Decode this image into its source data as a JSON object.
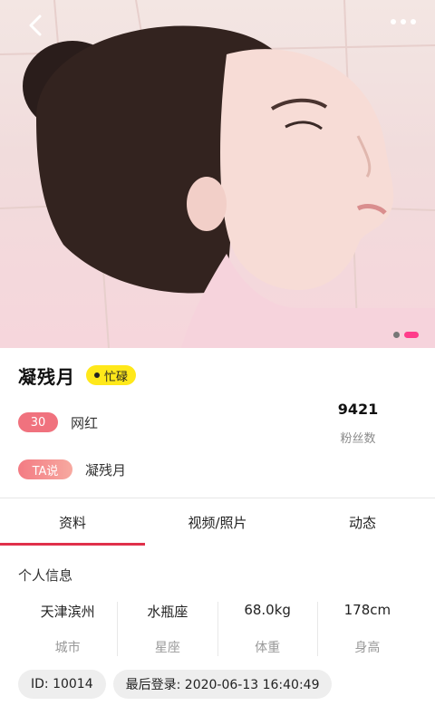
{
  "profile": {
    "name": "凝残月",
    "status": "忙碌",
    "age": "30",
    "tag": "网红",
    "ta_badge": "TA说",
    "ta_text": "凝残月",
    "fans_count": "9421",
    "fans_label": "粉丝数"
  },
  "carousel": {
    "current_index": 2,
    "total": 2
  },
  "tabs": [
    {
      "label": "资料",
      "active": true
    },
    {
      "label": "视频/照片",
      "active": false
    },
    {
      "label": "动态",
      "active": false
    }
  ],
  "section_title": "个人信息",
  "info": [
    {
      "value": "天津滨州",
      "label": "城市"
    },
    {
      "value": "水瓶座",
      "label": "星座"
    },
    {
      "value": "68.0kg",
      "label": "体重"
    },
    {
      "value": "178cm",
      "label": "身高"
    }
  ],
  "chips": {
    "id": "ID: 10014",
    "last_login": "最后登录: 2020-06-13 16:40:49"
  },
  "icons": {
    "back": "back-arrow-icon",
    "more": "more-dots-icon"
  },
  "colors": {
    "accent": "#e0304a",
    "status_bg": "#ffe81a",
    "age_badge": "#f0727e",
    "dot_active": "#ff3d8b"
  }
}
